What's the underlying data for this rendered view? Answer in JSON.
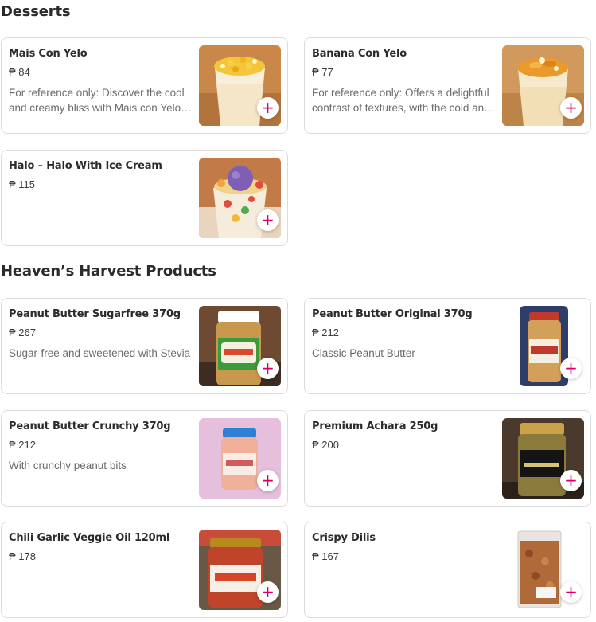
{
  "sections": [
    {
      "title": "Desserts",
      "items": [
        {
          "name": "Mais Con Yelo",
          "price": "₱ 84",
          "description": "For reference only: Discover the cool and creamy bliss with Mais con Yelo…",
          "image": "mais-con-yelo-photo"
        },
        {
          "name": "Banana Con Yelo",
          "price": "₱ 77",
          "description": "For reference only: Offers a delightful contrast of textures, with the cold an…",
          "image": "banana-con-yelo-photo"
        },
        {
          "name": "Halo – Halo With Ice Cream",
          "price": "₱ 115",
          "description": "",
          "image": "halo-halo-photo"
        }
      ]
    },
    {
      "title": "Heaven’s Harvest Products",
      "items": [
        {
          "name": "Peanut Butter Sugarfree 370g",
          "price": "₱ 267",
          "description": "Sugar-free and sweetened with Stevia",
          "image": "peanut-butter-sugarfree-photo"
        },
        {
          "name": "Peanut Butter Original 370g",
          "price": "₱ 212",
          "description": "Classic Peanut Butter",
          "image": "peanut-butter-original-photo"
        },
        {
          "name": "Peanut Butter Crunchy 370g",
          "price": "₱ 212",
          "description": "With crunchy peanut bits",
          "image": "peanut-butter-crunchy-photo"
        },
        {
          "name": "Premium Achara 250g",
          "price": "₱ 200",
          "description": "",
          "image": "premium-achara-photo"
        },
        {
          "name": "Chili Garlic Veggie Oil 120ml",
          "price": "₱ 178",
          "description": "",
          "image": "chili-garlic-oil-photo"
        },
        {
          "name": "Crispy Dilis",
          "price": "₱ 167",
          "description": "",
          "image": "crispy-dilis-photo"
        }
      ]
    }
  ],
  "add_button_label": "+",
  "accent_color": "#d7006a"
}
